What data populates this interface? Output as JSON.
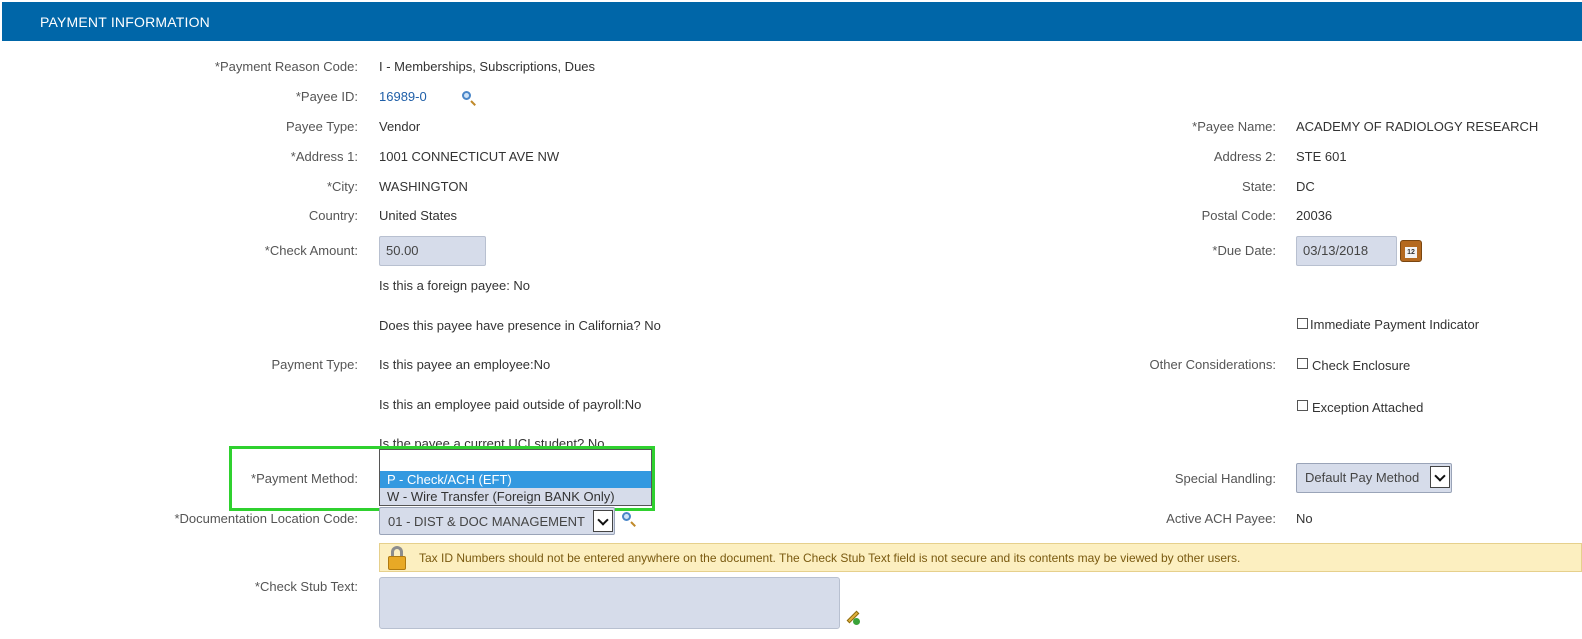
{
  "header": {
    "title": "PAYMENT INFORMATION"
  },
  "left": {
    "payment_reason_code": {
      "label": "*Payment Reason Code:",
      "value": "I - Memberships, Subscriptions, Dues"
    },
    "payee_id": {
      "label": "*Payee ID:",
      "value": "16989-0"
    },
    "payee_type": {
      "label": "Payee Type:",
      "value": "Vendor"
    },
    "address1": {
      "label": "*Address 1:",
      "value": "1001 CONNECTICUT AVE NW"
    },
    "city": {
      "label": "*City:",
      "value": "WASHINGTON"
    },
    "country": {
      "label": "Country:",
      "value": "United States"
    },
    "check_amount": {
      "label": "*Check Amount:",
      "value": "50.00"
    },
    "payment_type": {
      "label": "Payment Type:"
    },
    "payment_method": {
      "label": "*Payment Method:"
    },
    "doc_location": {
      "label": "*Documentation Location Code:",
      "value": "01 - DIST & DOC MANAGEMENT"
    },
    "check_stub": {
      "label": "*Check Stub Text:"
    }
  },
  "questions": {
    "foreign": "Is this a foreign payee: No",
    "california": "Does this payee have presence in California?  No",
    "employee": "Is this payee an employee:No",
    "outside_payroll": "Is this an employee paid outside of payroll:No",
    "student": "Is the payee a current UCI student?  No"
  },
  "payment_method_dropdown": {
    "options": [
      {
        "label": "P - Check/ACH (EFT)",
        "selected": true
      },
      {
        "label": "W - Wire Transfer (Foreign BANK Only)",
        "selected": false
      }
    ]
  },
  "right": {
    "payee_name": {
      "label": "*Payee Name:",
      "value": "ACADEMY OF RADIOLOGY RESEARCH"
    },
    "address2": {
      "label": "Address 2:",
      "value": "STE 601"
    },
    "state": {
      "label": "State:",
      "value": "DC"
    },
    "postal_code": {
      "label": "Postal Code:",
      "value": "20036"
    },
    "due_date": {
      "label": "*Due Date:",
      "value": "03/13/2018",
      "calendar_day": "12"
    },
    "immediate_payment": "Immediate Payment Indicator",
    "other_considerations": {
      "label": "Other Considerations:",
      "check_enclosure": "Check Enclosure",
      "exception_attached": "Exception Attached"
    },
    "special_handling": {
      "label": "Special Handling:",
      "value": "Default Pay Method"
    },
    "active_ach": {
      "label": "Active ACH Payee:",
      "value": "No"
    }
  },
  "warning": {
    "text": "Tax ID Numbers should not be entered anywhere on the document. The Check Stub Text field is not secure and its contents may be viewed by other users."
  },
  "colors": {
    "header": "#0066a8",
    "highlight": "#2fd12f",
    "selected_option": "#3399e0",
    "warning_bg": "#fcefc0"
  },
  "icons": {
    "payee_lookup": "magnifier-icon",
    "doc_lookup": "magnifier-icon",
    "due_date_picker": "calendar-icon",
    "warning": "lock-icon",
    "stub_edit": "pencil-icon"
  }
}
